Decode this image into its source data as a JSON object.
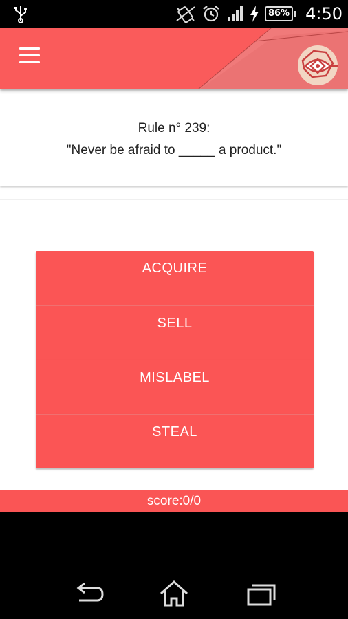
{
  "status_bar": {
    "time": "4:50",
    "battery": "86%",
    "icons": [
      "usb-icon",
      "vibrate-icon",
      "alarm-icon",
      "signal-icon",
      "charging-icon",
      "battery-icon"
    ]
  },
  "app_bar": {
    "color": "#fa5b5b",
    "menu_icon": "hamburger-menu-icon",
    "logo_icon": "eye-logo-icon"
  },
  "question": {
    "rule": "Rule n° 239:",
    "text": "\"Never be afraid to _____ a product.\""
  },
  "answers": [
    {
      "label": "ACQUIRE"
    },
    {
      "label": "SELL"
    },
    {
      "label": "MISLABEL"
    },
    {
      "label": "STEAL"
    }
  ],
  "score": "score:0/0",
  "nav_bar": {
    "icons": [
      "back-icon",
      "home-icon",
      "recent-apps-icon"
    ]
  }
}
